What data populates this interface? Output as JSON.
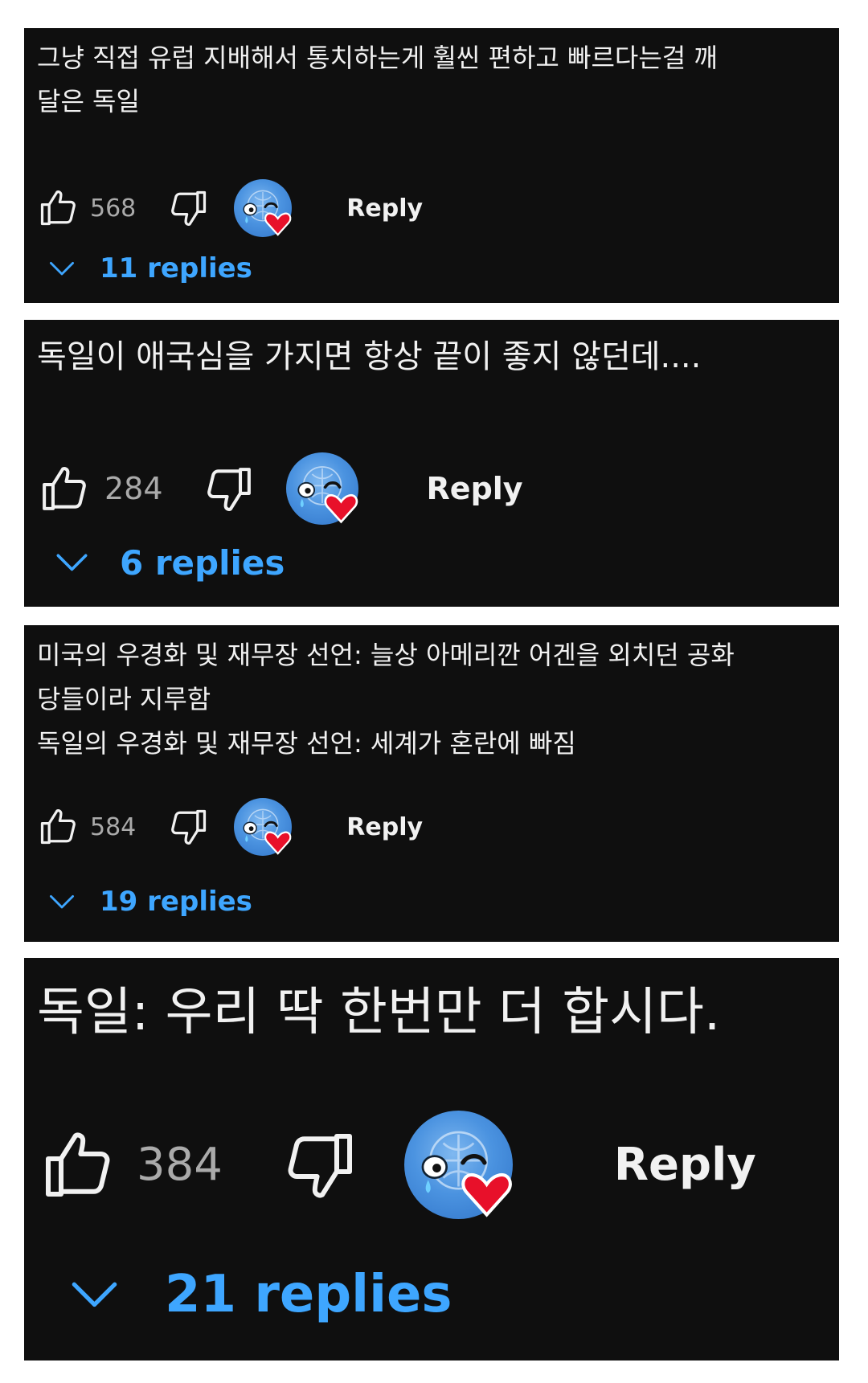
{
  "colors": {
    "background": "#0f0f0f",
    "text": "#f1f1f1",
    "count": "#aaaaaa",
    "replies_link": "#3ea6ff",
    "heart": "#e8102a"
  },
  "comments": [
    {
      "text": "그냥 직접 유럽 지배해서 통치하는게 훨씬 편하고 빠르다는걸 깨\n달은 독일",
      "likes": "568",
      "reply_label": "Reply",
      "replies_label": "11 replies",
      "icons": [
        "thumbs-up-icon",
        "thumbs-down-icon",
        "creator-heart-avatar",
        "chevron-down-icon"
      ]
    },
    {
      "text": "독일이 애국심을 가지면 항상 끝이 좋지 않던데....",
      "likes": "284",
      "reply_label": "Reply",
      "replies_label": "6 replies",
      "icons": [
        "thumbs-up-icon",
        "thumbs-down-icon",
        "creator-heart-avatar",
        "chevron-down-icon"
      ]
    },
    {
      "text": "미국의 우경화 및 재무장 선언: 늘상 아메리깐 어겐을 외치던 공화\n당들이라 지루함\n독일의 우경화 및 재무장 선언: 세계가 혼란에 빠짐",
      "likes": "584",
      "reply_label": "Reply",
      "replies_label": "19 replies",
      "icons": [
        "thumbs-up-icon",
        "thumbs-down-icon",
        "creator-heart-avatar",
        "chevron-down-icon"
      ]
    },
    {
      "text": "독일: 우리 딱 한번만 더 합시다.",
      "likes": "384",
      "reply_label": "Reply",
      "replies_label": "21 replies",
      "icons": [
        "thumbs-up-icon",
        "thumbs-down-icon",
        "creator-heart-avatar",
        "chevron-down-icon"
      ]
    }
  ]
}
